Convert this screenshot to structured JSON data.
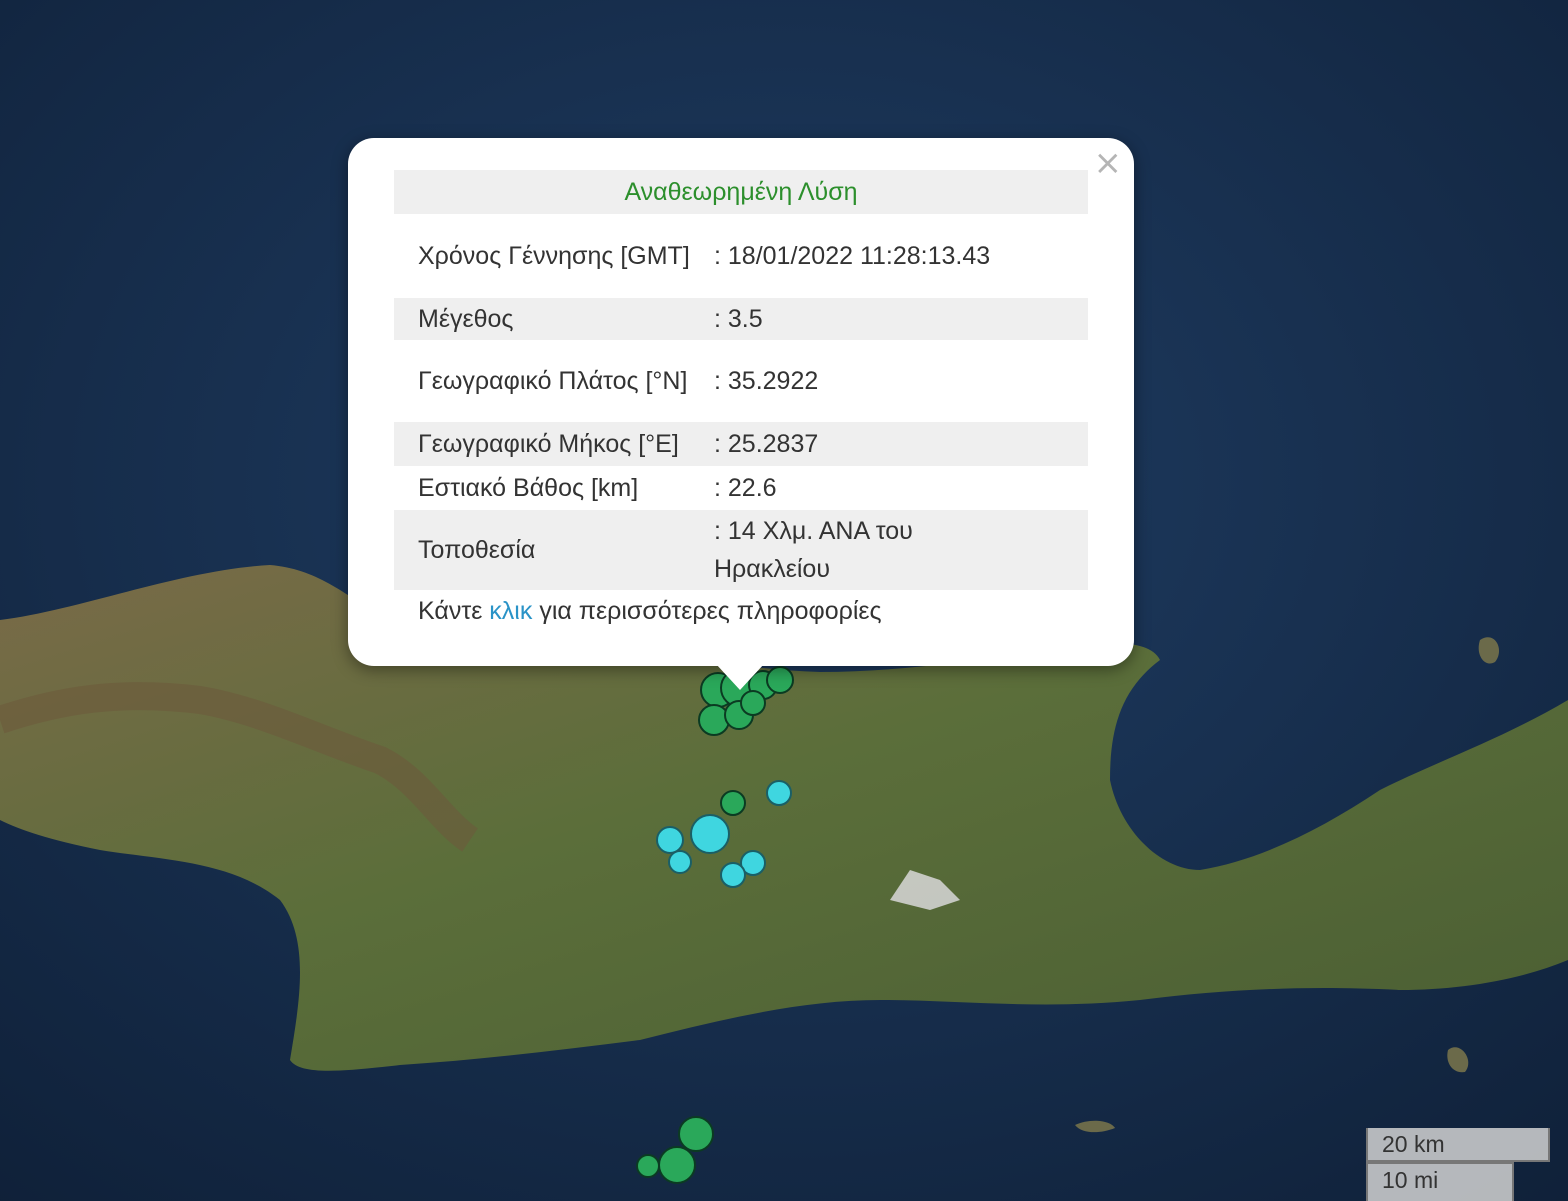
{
  "popup": {
    "title": "Αναθεωρημένη Λύση",
    "close_icon": "×",
    "rows": [
      {
        "label": "Χρόνος Γέννησης [GMT]",
        "value": ": 18/01/2022 11:28:13.43"
      },
      {
        "label": "Μέγεθος",
        "value": ": 3.5"
      },
      {
        "label": "Γεωγραφικό Πλάτος [°N]",
        "value": ": 35.2922"
      },
      {
        "label": "Γεωγραφικό Μήκος [°E]",
        "value": ": 25.2837"
      },
      {
        "label": "Εστιακό Βάθος [km]",
        "value": ": 22.6"
      },
      {
        "label": "Τοποθεσία",
        "value": ": 14 Χλμ. ΑΝΑ του Ηρακλείου"
      }
    ],
    "footer_prefix": "Κάντε",
    "footer_link": "κλικ",
    "footer_suffix": "για περισσότερες πληροφορίες"
  },
  "scale": {
    "metric": "20 km",
    "imperial": "10 mi"
  },
  "colors": {
    "title_green": "#2c8f2c",
    "link_blue": "#2a93c7",
    "marker_green": "#2aa85a",
    "marker_cyan": "#3fd6e0"
  }
}
